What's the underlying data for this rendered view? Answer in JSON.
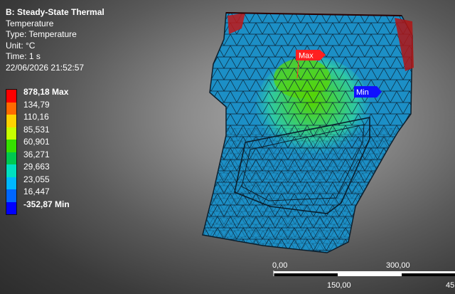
{
  "info": {
    "title": "B: Steady-State Thermal",
    "type_line": "Temperature",
    "type_label": "Type: Temperature",
    "unit": "Unit: °C",
    "time": "Time: 1 s",
    "timestamp": "22/06/2026 21:52:57"
  },
  "legend": {
    "labels": [
      "878,18 Max",
      "134,79",
      "110,16",
      "85,531",
      "60,901",
      "36,271",
      "29,663",
      "23,055",
      "16,447",
      "-352,87 Min"
    ],
    "colors": [
      "#ff0000",
      "#ff6a00",
      "#ffd200",
      "#c7ff00",
      "#36e000",
      "#00c850",
      "#00e0c0",
      "#00b8ff",
      "#0066ff",
      "#0000ff"
    ]
  },
  "probes": {
    "max_label": "Max",
    "min_label": "Min"
  },
  "scale_bar": {
    "labels_top": [
      "0,00",
      "300,00"
    ],
    "labels_bottom": [
      "150,00",
      "45"
    ]
  }
}
